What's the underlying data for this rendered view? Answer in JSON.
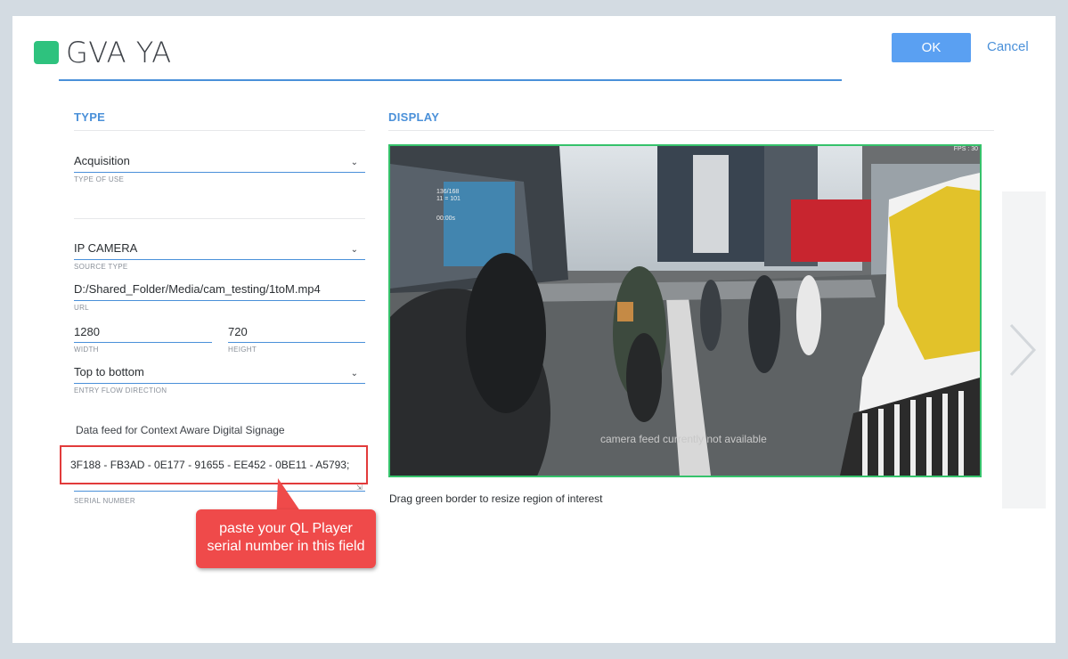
{
  "header": {
    "title": "GVA YA",
    "swatch_color": "#2ec27e",
    "ok_label": "OK",
    "cancel_label": "Cancel"
  },
  "type_section": {
    "heading": "TYPE",
    "type_of_use": {
      "value": "Acquisition",
      "caption": "TYPE OF USE"
    },
    "source_type": {
      "value": "IP CAMERA",
      "caption": "SOURCE TYPE"
    },
    "url": {
      "value": "D:/Shared_Folder/Media/cam_testing/1toM.mp4",
      "caption": "URL"
    },
    "width": {
      "value": "1280",
      "caption": "WIDTH"
    },
    "height": {
      "value": "720",
      "caption": "HEIGHT"
    },
    "entry_flow": {
      "value": "Top to bottom",
      "caption": "ENTRY FLOW DIRECTION"
    },
    "data_feed_label": "Data feed for Context Aware Digital Signage",
    "serial_number": {
      "value": "3F188 - FB3AD - 0E177 - 91655 - EE452 - 0BE11 - A5793;",
      "caption": "SERIAL NUMBER"
    }
  },
  "callout": {
    "line1": "paste your QL Player",
    "line2": "serial number in this field"
  },
  "display_section": {
    "heading": "DISPLAY",
    "feed_message": "camera feed currently not available",
    "fps_label": "FPS : 30",
    "overlay_line1": "136/168",
    "overlay_line2": "11 = 101",
    "overlay_line3": "00:00s",
    "roi_hint": "Drag green border to resize region of interest"
  },
  "colors": {
    "accent": "#4a90d9",
    "ok_button": "#5aa0f2",
    "roi_border": "#35c26b",
    "callout": "#ef4a4a"
  },
  "icons": {
    "next": "chevron-right-icon",
    "dropdown": "chevron-down-icon"
  }
}
